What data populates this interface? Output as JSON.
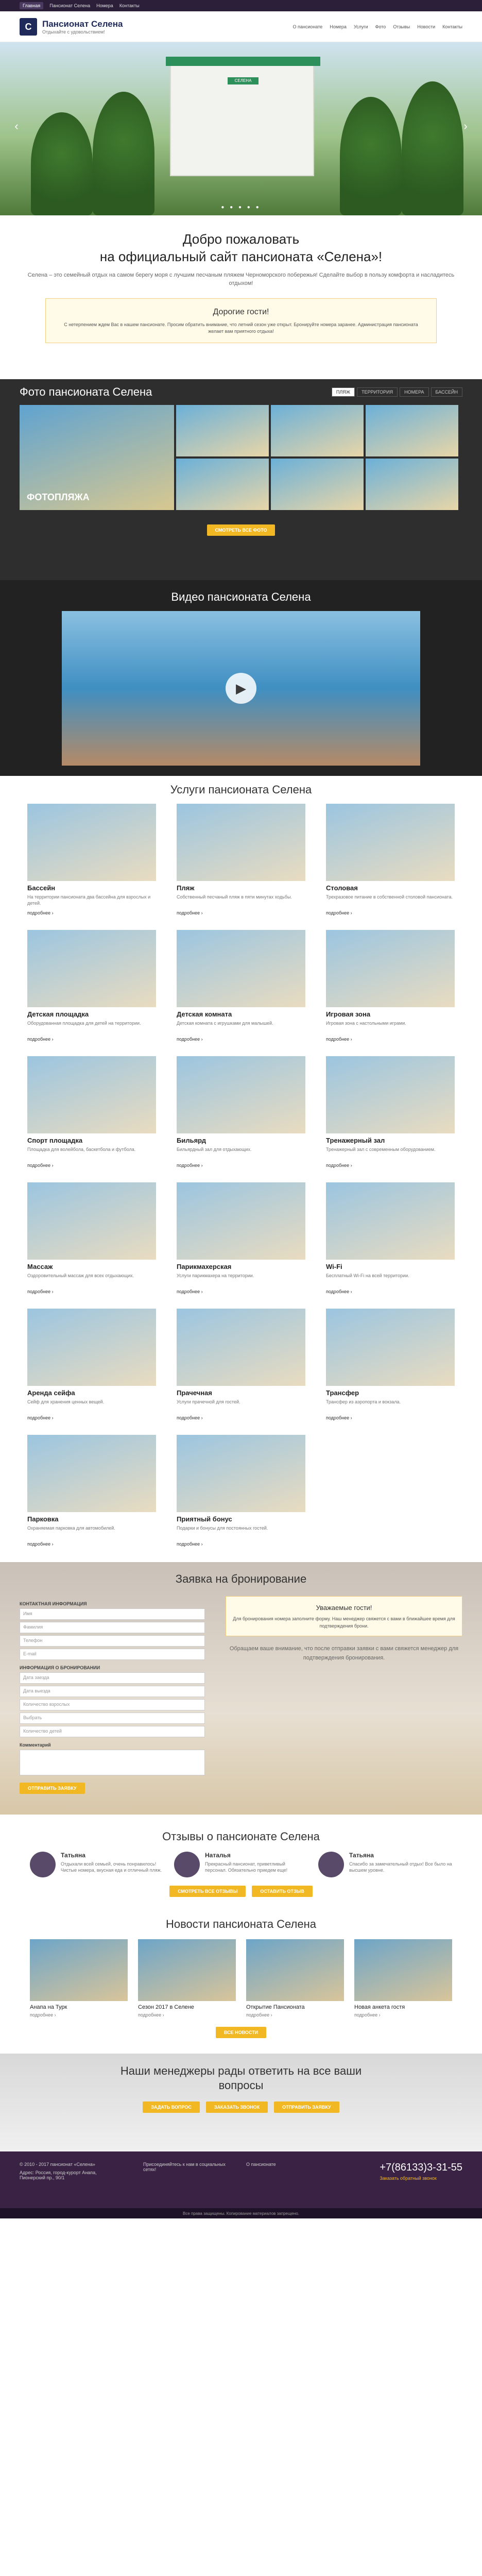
{
  "topbar": {
    "chip": "Главная",
    "links": [
      "Пансионат Селена",
      "Номера",
      "Контакты"
    ]
  },
  "header": {
    "logo_letter": "С",
    "brand_name": "Пансионат Селена",
    "tagline": "Отдыхайте с удовольствием!",
    "nav": [
      "О пансионате",
      "Номера",
      "Услуги",
      "Фото",
      "Отзывы",
      "Новости",
      "Контакты"
    ]
  },
  "hero": {
    "sign": "СЕЛЕНА",
    "prev": "‹",
    "next": "›",
    "dots": "● ● ● ● ●"
  },
  "welcome": {
    "title_1": "Добро пожаловать",
    "title_2": "на официальный сайт пансионата «Селена»!",
    "text": "Селена – это семейный отдых на самом берегу моря с лучшим песчаным пляжем Черноморского побережья! Сделайте выбор в пользу комфорта и насладитесь отдыхом!"
  },
  "notice": {
    "title": "Дорогие гости!",
    "text": "С нетерпением ждем Вас в нашем пансионате. Просим обратить внимание, что летний сезон уже открыт. Бронируйте номера заранее. Администрация пансионата желает вам приятного отдыха!"
  },
  "photos": {
    "title": "Фото пансионата Селена",
    "tabs": [
      "ПЛЯЖ",
      "ТЕРРИТОРИЯ",
      "НОМЕРА",
      "БАССЕЙН"
    ],
    "big_label": "ФОТОПЛЯЖА",
    "button": "СМОТРЕТЬ ВСЕ ФОТО"
  },
  "video": {
    "title": "Видео пансионата Селена",
    "play": "▶"
  },
  "services": {
    "title": "Услуги пансионата Селена",
    "more": "подробнее ›",
    "items": [
      {
        "t": "Бассейн",
        "d": "На территории пансионата два бассейна для взрослых и детей."
      },
      {
        "t": "Пляж",
        "d": "Собственный песчаный пляж в пяти минутах ходьбы."
      },
      {
        "t": "Столовая",
        "d": "Трехразовое питание в собственной столовой пансионата."
      },
      {
        "t": "Детская площадка",
        "d": "Оборудованная площадка для детей на территории."
      },
      {
        "t": "Детская комната",
        "d": "Детская комната с игрушками для малышей."
      },
      {
        "t": "Игровая зона",
        "d": "Игровая зона с настольными играми."
      },
      {
        "t": "Спорт площадка",
        "d": "Площадка для волейбола, баскетбола и футбола."
      },
      {
        "t": "Бильярд",
        "d": "Бильярдный зал для отдыхающих."
      },
      {
        "t": "Тренажерный зал",
        "d": "Тренажерный зал с современным оборудованием."
      },
      {
        "t": "Массаж",
        "d": "Оздоровительный массаж для всех отдыхающих."
      },
      {
        "t": "Парикмахерская",
        "d": "Услуги парикмахера на территории."
      },
      {
        "t": "Wi-Fi",
        "d": "Бесплатный Wi-Fi на всей территории."
      },
      {
        "t": "Аренда сейфа",
        "d": "Сейф для хранения ценных вещей."
      },
      {
        "t": "Прачечная",
        "d": "Услуги прачечной для гостей."
      },
      {
        "t": "Трансфер",
        "d": "Трансфер из аэропорта и вокзала."
      },
      {
        "t": "Парковка",
        "d": "Охраняемая парковка для автомобилей."
      },
      {
        "t": "Приятный бонус",
        "d": "Подарки и бонусы для постоянных гостей."
      }
    ]
  },
  "booking": {
    "title": "Заявка на бронирование",
    "contact_label": "КОНТАКТНАЯ ИНФОРМАЦИЯ",
    "fields": [
      "Имя",
      "Фамилия",
      "Телефон",
      "E-mail"
    ],
    "booking_label": "ИНФОРМАЦИЯ О БРОНИРОВАНИИ",
    "booking_fields": [
      "Дата заезда",
      "Дата выезда",
      "Количество взрослых",
      "Выбрать",
      "Количество детей"
    ],
    "comment_label": "Комментарий",
    "submit": "ОТПРАВИТЬ ЗАЯВКУ",
    "card_title": "Уважаемые гости!",
    "card_text": "Для бронирования номера заполните форму. Наш менеджер свяжется с вами в ближайшее время для подтверждения брони.",
    "aside_text": "Обращаем ваше внимание, что после отправки заявки с вами свяжется менеджер для подтверждения бронирования."
  },
  "reviews": {
    "title": "Отзывы о пансионате Селена",
    "items": [
      {
        "n": "Татьяна",
        "tx": "Отдыхали всей семьей, очень понравилось! Чистые номера, вкусная еда и отличный пляж."
      },
      {
        "n": "Наталья",
        "tx": "Прекрасный пансионат, приветливый персонал. Обязательно приедем еще!"
      },
      {
        "n": "Татьяна",
        "tx": "Спасибо за замечательный отдых! Все было на высшем уровне."
      }
    ],
    "btn_all": "СМОТРЕТЬ ВСЕ ОТЗЫВЫ",
    "btn_add": "ОСТАВИТЬ ОТЗЫВ"
  },
  "news": {
    "title": "Новости пансионата Селена",
    "items": [
      {
        "t": "Анапа на Турк",
        "d": "подробнее ›"
      },
      {
        "t": "Сезон 2017 в Селене",
        "d": "подробнее ›"
      },
      {
        "t": "Открытие Пансионата",
        "d": "подробнее ›"
      },
      {
        "t": "Новая анкета гостя",
        "d": "подробнее ›"
      }
    ],
    "button": "ВСЕ НОВОСТИ"
  },
  "managers": {
    "title_1": "Наши менеджеры рады ответить на все ваши",
    "title_2": "вопросы",
    "buttons": [
      "ЗАДАТЬ ВОПРОС",
      "ЗАКАЗАТЬ ЗВОНОК",
      "ОТПРАВИТЬ ЗАЯВКУ"
    ]
  },
  "footer": {
    "copy": "© 2010 - 2017 пансионат «Селена»",
    "address": "Адрес: Россия, город-курорт Анапа, Пионерский пр., 90/1",
    "col2": "Присоединяйтесь к нам в социальных сетях!",
    "col3": "О пансионате",
    "phone": "+7(86133)3-31-55",
    "callback": "Заказать обратный звонок",
    "bottom": "Все права защищены. Копирование материалов запрещено."
  }
}
